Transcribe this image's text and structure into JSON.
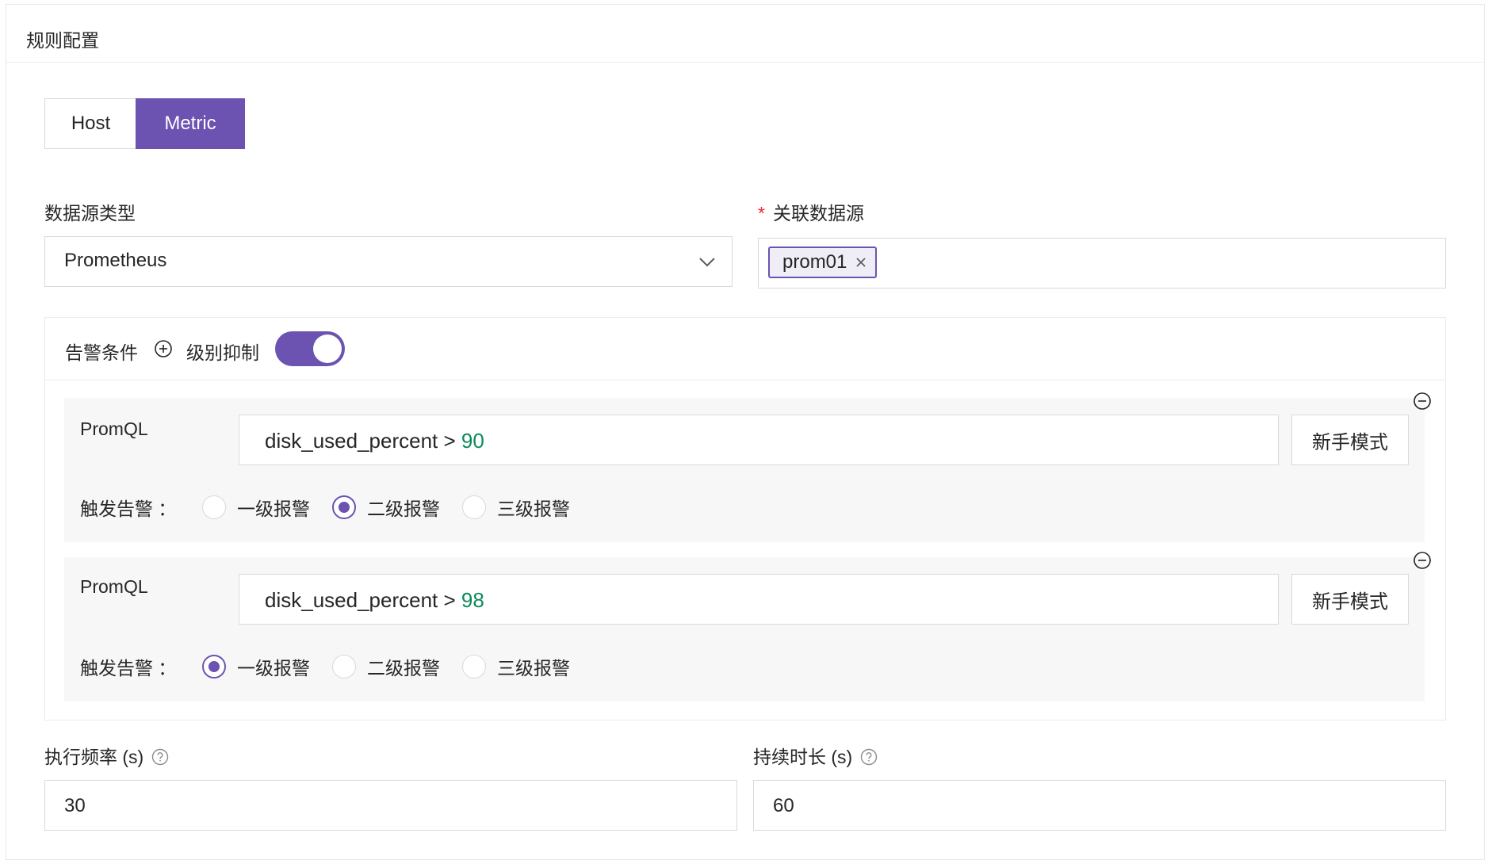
{
  "card": {
    "title": "规则配置"
  },
  "mode_switch": {
    "host_label": "Host",
    "metric_label": "Metric",
    "selected": "Metric"
  },
  "datasource_type": {
    "label": "数据源类型",
    "value": "Prometheus"
  },
  "related_datasource": {
    "required_mark": "*",
    "label": "关联数据源",
    "tags": [
      "prom01"
    ]
  },
  "conditions": {
    "label": "告警条件",
    "level_suppress_label": "级别抑制",
    "level_suppress_on": true,
    "rules": [
      {
        "field_label": "PromQL",
        "query_prefix": "disk_used_percent > ",
        "query_threshold": "90",
        "novice_button": "新手模式",
        "trigger_label": "触发告警 ：",
        "levels": [
          "一级报警",
          "二级报警",
          "三级报警"
        ],
        "selected_level": "二级报警"
      },
      {
        "field_label": "PromQL",
        "query_prefix": "disk_used_percent > ",
        "query_threshold": "98",
        "novice_button": "新手模式",
        "trigger_label": "触发告警 ：",
        "levels": [
          "一级报警",
          "二级报警",
          "三级报警"
        ],
        "selected_level": "一级报警"
      }
    ]
  },
  "exec_frequency": {
    "label": "执行频率 (s)",
    "value": "30"
  },
  "duration": {
    "label": "持续时长 (s)",
    "value": "60"
  },
  "colors": {
    "accent": "#6c53b1",
    "number": "#0b8a5a",
    "required": "#f5222d"
  },
  "icons": {
    "chevron": "chevron-down-icon",
    "tag_close": "close-icon",
    "add": "plus-circle-icon",
    "remove": "minus-circle-icon",
    "help": "question-circle-icon"
  }
}
